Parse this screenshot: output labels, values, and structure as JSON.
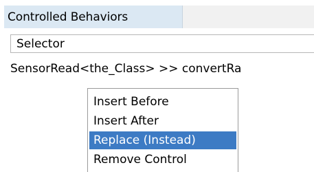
{
  "header": {
    "tab_label": "Controlled Behaviors"
  },
  "table": {
    "column_header": "Selector",
    "rows": [
      {
        "selector": "SensorRead<the_Class> >> convertRa"
      }
    ]
  },
  "context_menu": {
    "items": [
      {
        "label": "Insert Before",
        "selected": false
      },
      {
        "label": "Insert After",
        "selected": false
      },
      {
        "label": "Replace (Instead)",
        "selected": true
      },
      {
        "label": "Remove Control",
        "selected": false
      }
    ]
  },
  "colors": {
    "tab_background": "#dbe8f3",
    "selection": "#3d7bc4"
  }
}
